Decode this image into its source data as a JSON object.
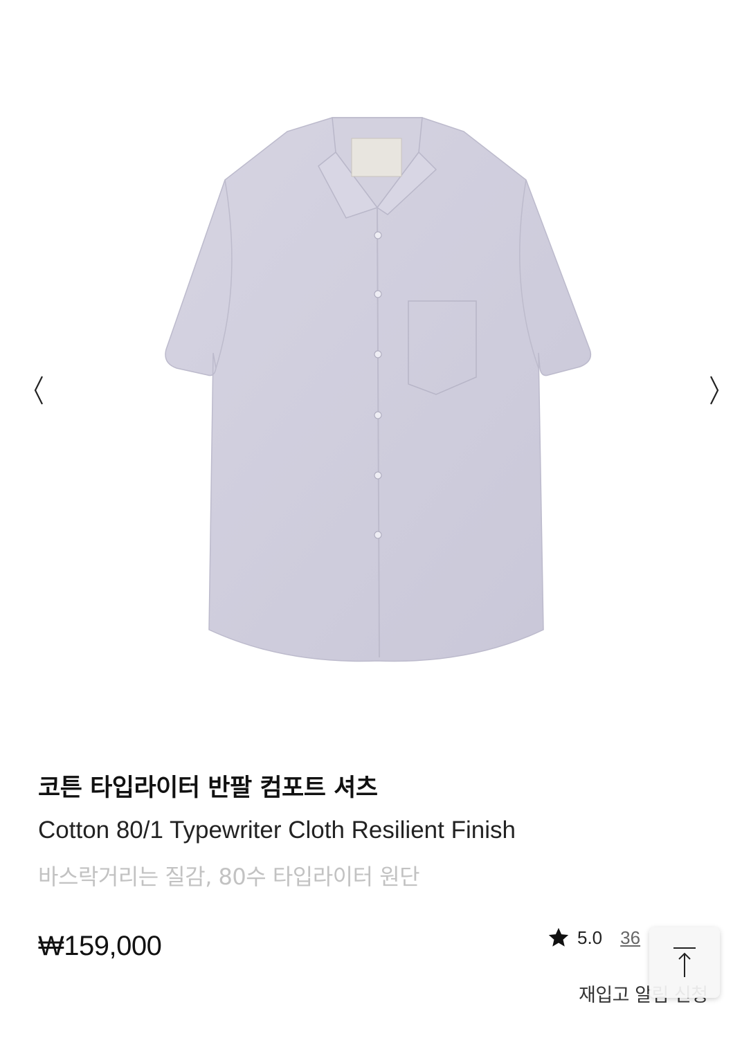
{
  "product": {
    "name_ko": "코튼 타입라이터 반팔 컴포트 셔츠",
    "name_en": "Cotton 80/1 Typewriter Cloth Resilient Finish",
    "description": "바스락거리는 질감, 80수 타입라이터 원단",
    "price": "₩159,000",
    "rating": "5.0",
    "review_count": "36",
    "image_color": "#cfcddd"
  },
  "gallery": {
    "prev_icon": "chevron-left-icon",
    "next_icon": "chevron-right-icon"
  },
  "actions": {
    "restock_label": "재입고 알림 신청",
    "scroll_top_icon": "arrow-up-icon"
  }
}
